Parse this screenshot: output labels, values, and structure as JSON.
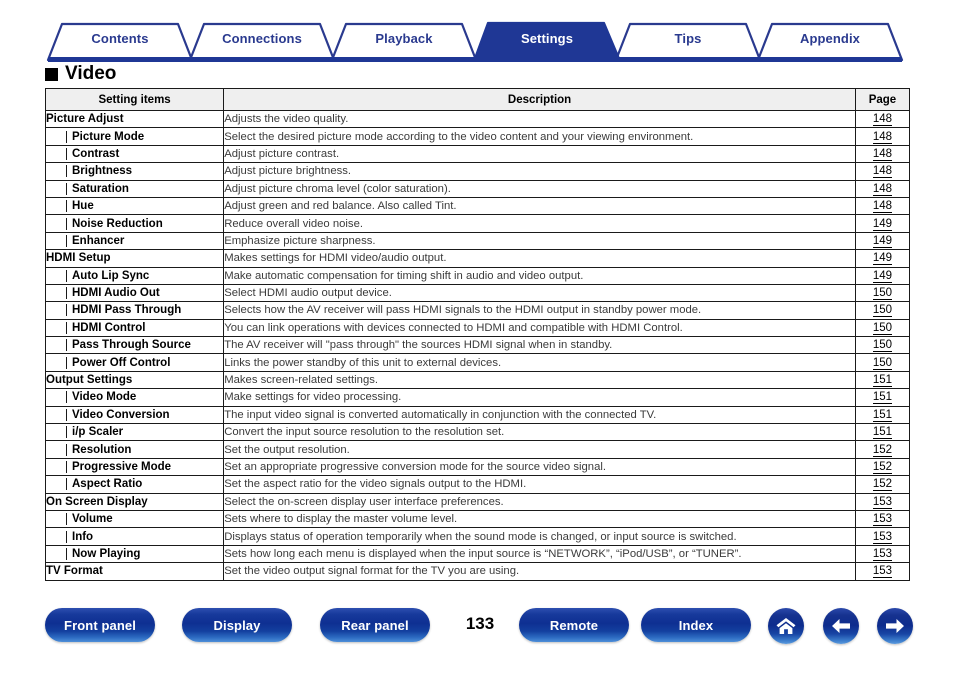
{
  "tabs": [
    {
      "label": "Contents",
      "active": false
    },
    {
      "label": "Connections",
      "active": false
    },
    {
      "label": "Playback",
      "active": false
    },
    {
      "label": "Settings",
      "active": true
    },
    {
      "label": "Tips",
      "active": false
    },
    {
      "label": "Appendix",
      "active": false
    }
  ],
  "section": {
    "title": "Video",
    "marker": "black-square"
  },
  "table": {
    "headers": [
      "Setting items",
      "Description",
      "Page"
    ],
    "rows": [
      {
        "item": "Picture Adjust",
        "level": 0,
        "desc": "Adjusts the video quality.",
        "page": "148"
      },
      {
        "item": "Picture Mode",
        "level": 1,
        "desc": "Select the desired picture mode according to the video content and your viewing environment.",
        "page": "148"
      },
      {
        "item": "Contrast",
        "level": 1,
        "desc": "Adjust picture contrast.",
        "page": "148"
      },
      {
        "item": "Brightness",
        "level": 1,
        "desc": "Adjust picture brightness.",
        "page": "148"
      },
      {
        "item": "Saturation",
        "level": 1,
        "desc": "Adjust picture chroma level (color saturation).",
        "page": "148"
      },
      {
        "item": "Hue",
        "level": 1,
        "desc": "Adjust green and red balance. Also called Tint.",
        "page": "148"
      },
      {
        "item": "Noise Reduction",
        "level": 1,
        "desc": "Reduce overall video noise.",
        "page": "149"
      },
      {
        "item": "Enhancer",
        "level": 1,
        "desc": "Emphasize picture sharpness.",
        "page": "149"
      },
      {
        "item": "HDMI Setup",
        "level": 0,
        "desc": "Makes settings for HDMI video/audio output.",
        "page": "149"
      },
      {
        "item": "Auto Lip Sync",
        "level": 1,
        "desc": "Make automatic compensation for timing shift in audio and video output.",
        "page": "149"
      },
      {
        "item": "HDMI Audio Out",
        "level": 1,
        "desc": "Select HDMI audio output device.",
        "page": "150"
      },
      {
        "item": "HDMI Pass Through",
        "level": 1,
        "desc": "Selects how the AV receiver will pass HDMI signals to the HDMI output in standby power mode.",
        "page": "150"
      },
      {
        "item": "HDMI Control",
        "level": 1,
        "desc": "You can link operations with devices connected to HDMI and compatible with HDMI Control.",
        "page": "150"
      },
      {
        "item": "Pass Through Source",
        "level": 1,
        "desc": "The AV receiver will \"pass through\" the sources HDMI signal when in standby.",
        "page": "150"
      },
      {
        "item": "Power Off Control",
        "level": 1,
        "desc": "Links the power standby of this unit to external devices.",
        "page": "150"
      },
      {
        "item": "Output Settings",
        "level": 0,
        "desc": "Makes screen-related settings.",
        "page": "151"
      },
      {
        "item": "Video Mode",
        "level": 1,
        "desc": "Make settings for video processing.",
        "page": "151"
      },
      {
        "item": "Video Conversion",
        "level": 1,
        "desc": "The input video signal is converted automatically in conjunction with the connected TV.",
        "page": "151"
      },
      {
        "item": "i/p Scaler",
        "level": 1,
        "desc": "Convert the input source resolution to the resolution set.",
        "page": "151"
      },
      {
        "item": "Resolution",
        "level": 1,
        "desc": "Set the output resolution.",
        "page": "152"
      },
      {
        "item": "Progressive Mode",
        "level": 1,
        "desc": "Set an appropriate progressive conversion mode for the source video signal.",
        "page": "152"
      },
      {
        "item": "Aspect Ratio",
        "level": 1,
        "desc": "Set the aspect ratio for the video signals output to the HDMI.",
        "page": "152"
      },
      {
        "item": "On Screen Display",
        "level": 0,
        "desc": "Select the on-screen display user interface preferences.",
        "page": "153"
      },
      {
        "item": "Volume",
        "level": 1,
        "desc": "Sets where to display the master volume level.",
        "page": "153"
      },
      {
        "item": "Info",
        "level": 1,
        "desc": "Displays status of operation temporarily when the sound mode is changed, or input source is switched.",
        "page": "153"
      },
      {
        "item": "Now Playing",
        "level": 1,
        "desc": "Sets how long each menu is displayed when the input source is “NETWORK”, “iPod/USB”, or “TUNER”.",
        "page": "153"
      },
      {
        "item": "TV Format",
        "level": 0,
        "desc": "Set the video output signal format for the TV you are using.",
        "page": "153"
      }
    ]
  },
  "footer": {
    "buttons": [
      {
        "label": "Front panel"
      },
      {
        "label": "Display"
      },
      {
        "label": "Rear panel"
      },
      {
        "label": "Remote"
      },
      {
        "label": "Index"
      }
    ],
    "page_number": "133",
    "icons": [
      {
        "name": "home-icon"
      },
      {
        "name": "arrow-left-icon"
      },
      {
        "name": "arrow-right-icon"
      }
    ]
  },
  "colors": {
    "brand_blue": "#2a3a8f",
    "tab_active_fill": "#1f3795",
    "button_blue": "#0e2f92",
    "header_fill": "#efefef"
  }
}
